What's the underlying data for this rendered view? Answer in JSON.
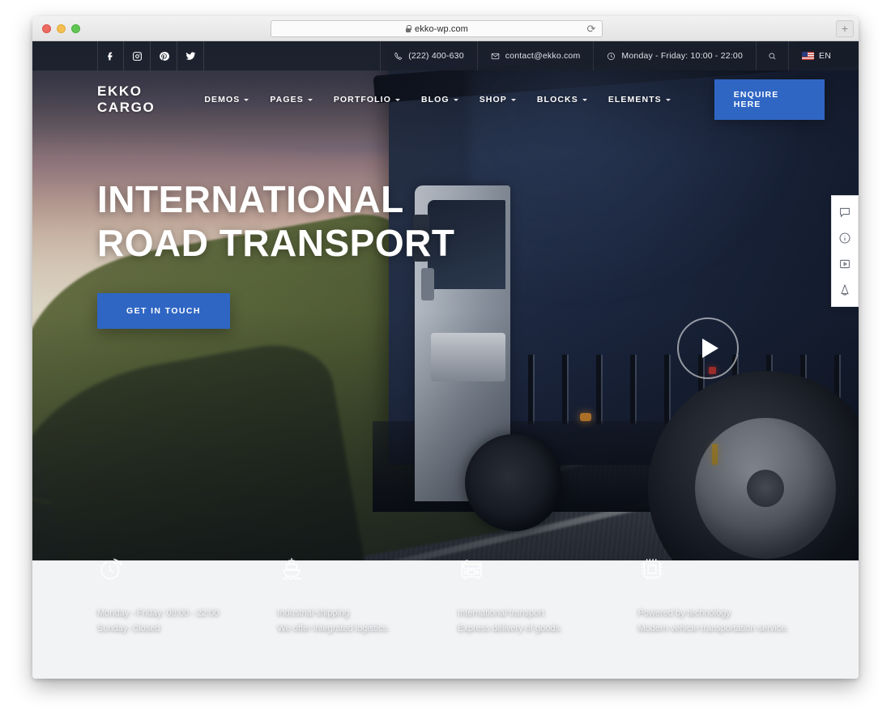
{
  "browser": {
    "url": "ekko-wp.com",
    "lock_icon": "lock-icon",
    "reload_icon": "reload-icon",
    "newtab_label": "+",
    "traffic_lights": [
      "close",
      "minimize",
      "maximize"
    ]
  },
  "topbar": {
    "socials": [
      {
        "name": "facebook-icon",
        "label": "f"
      },
      {
        "name": "instagram-icon",
        "label": "Instagram"
      },
      {
        "name": "pinterest-icon",
        "label": "Pinterest"
      },
      {
        "name": "twitter-icon",
        "label": "Twitter"
      }
    ],
    "phone": "(222) 400-630",
    "email": "contact@ekko.com",
    "hours": "Monday - Friday: 10:00 - 22:00",
    "search_icon": "search-icon",
    "language": "EN"
  },
  "nav": {
    "brand": "EKKO CARGO",
    "items": [
      {
        "label": "DEMOS",
        "has_dropdown": true
      },
      {
        "label": "PAGES",
        "has_dropdown": true
      },
      {
        "label": "PORTFOLIO",
        "has_dropdown": true
      },
      {
        "label": "BLOG",
        "has_dropdown": true
      },
      {
        "label": "SHOP",
        "has_dropdown": true
      },
      {
        "label": "BLOCKS",
        "has_dropdown": true
      },
      {
        "label": "ELEMENTS",
        "has_dropdown": true
      }
    ],
    "cta_label": "ENQUIRE HERE"
  },
  "hero": {
    "title_line1": "INTERNATIONAL",
    "title_line2": "ROAD TRANSPORT",
    "cta_label": "GET IN TOUCH",
    "play_icon": "play-icon"
  },
  "side_panel": {
    "items": [
      {
        "name": "chat-bubble-icon"
      },
      {
        "name": "info-circle-icon"
      },
      {
        "name": "video-play-icon"
      },
      {
        "name": "lamp-icon"
      }
    ]
  },
  "features": [
    {
      "icon": "clock-arrow-icon",
      "line1": "Monday - Friday: 08:00 - 22:00",
      "line2": "Sunday: Closed"
    },
    {
      "icon": "ship-icon",
      "line1": "Industrial shipping",
      "line2": "We offer integrated logistics."
    },
    {
      "icon": "truck-front-icon",
      "line1": "International transport",
      "line2": "Express delivery of goods."
    },
    {
      "icon": "cpu-chip-icon",
      "line1": "Powered by technology",
      "line2": "Modern vehicle transportation service."
    }
  ],
  "colors": {
    "accent_blue": "#2f66c4",
    "topbar_dark": "#1a1f2b",
    "page_below": "#f2f3f5"
  }
}
